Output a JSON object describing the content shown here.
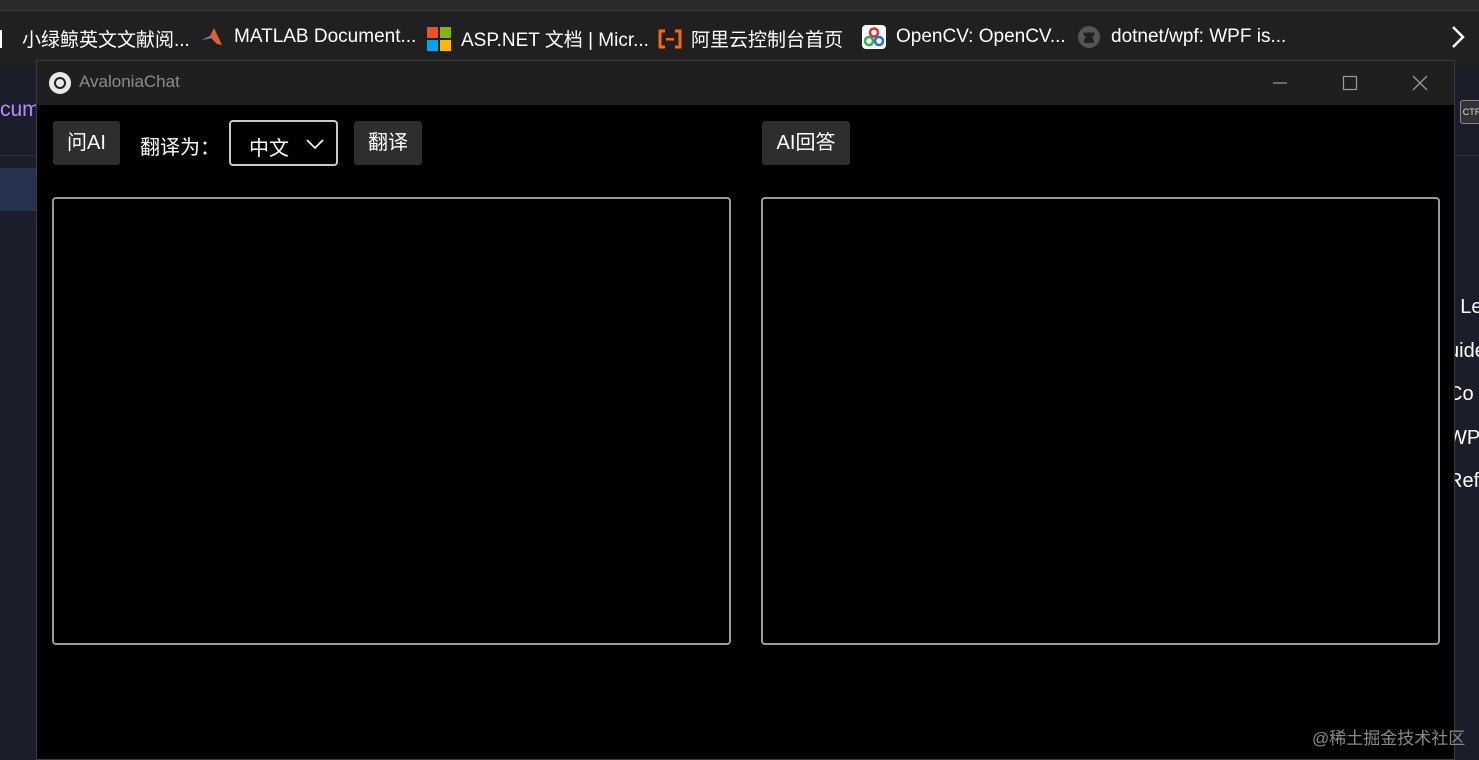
{
  "bookmarks": [
    {
      "label": "小绿鲸英文文献阅...",
      "icon": "whale-icon"
    },
    {
      "label": "MATLAB Document...",
      "icon": "matlab-icon"
    },
    {
      "label": "ASP.NET 文档 | Micr...",
      "icon": "microsoft-icon"
    },
    {
      "label": "阿里云控制台首页",
      "icon": "aliyun-icon"
    },
    {
      "label": "OpenCV: OpenCV...",
      "icon": "opencv-icon"
    },
    {
      "label": "dotnet/wpf: WPF is...",
      "icon": "github-icon"
    }
  ],
  "background": {
    "left_text": "cum",
    "right_items": [
      "r Le",
      "uide",
      "Co",
      "WP",
      "Refe"
    ],
    "ctrl_badge": "CTR",
    "watermark": "@稀土掘金技术社区"
  },
  "window": {
    "title": "AvaloniaChat",
    "controls": [
      "minimize-icon",
      "maximize-icon",
      "close-icon"
    ]
  },
  "toolbar": {
    "ask_label": "问AI",
    "translate_to_label": "翻译为：",
    "language_selected": "中文",
    "translate_label": "翻译",
    "ai_answer_label": "AI回答"
  },
  "colors": {
    "window_bg": "#000000",
    "titlebar_bg": "#1f1f1f",
    "button_bg": "#2e2e2e",
    "textbox_border": "#9a9a9a"
  }
}
